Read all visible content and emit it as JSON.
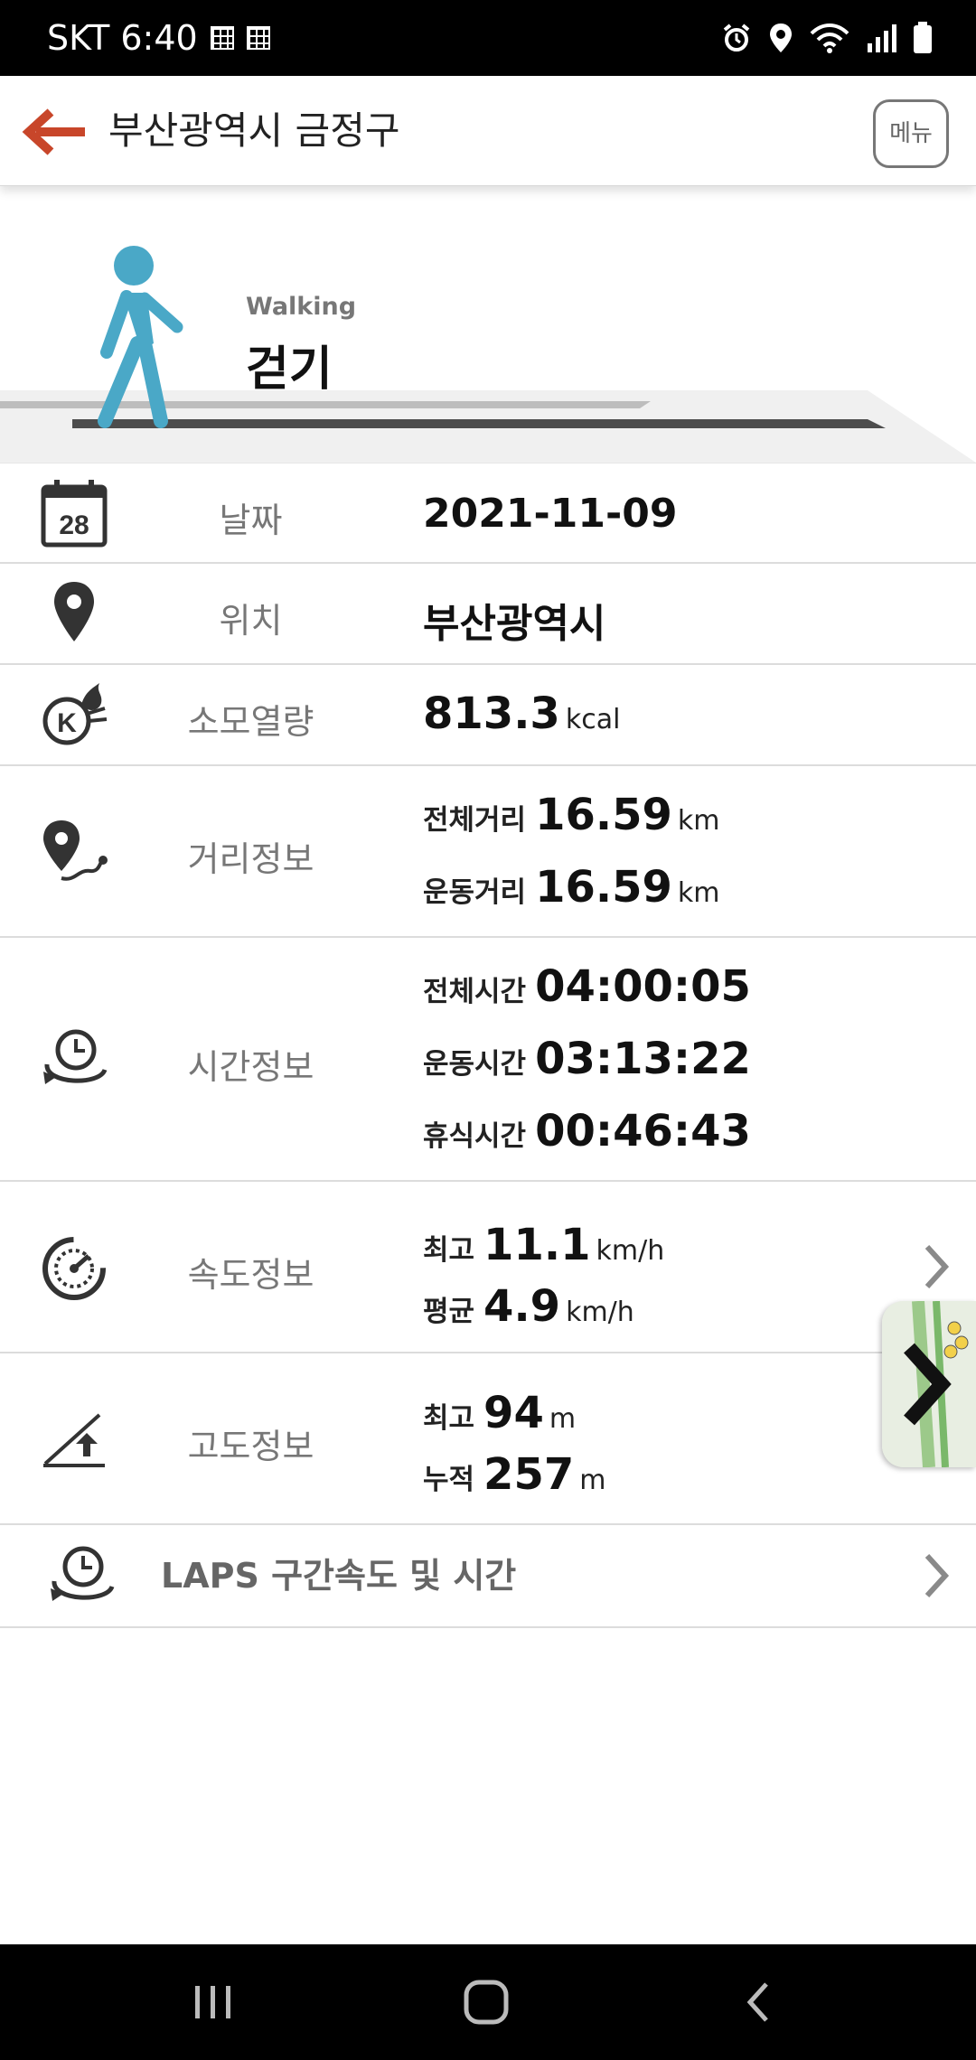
{
  "status_bar": {
    "carrier_time": "SKT 6:40"
  },
  "header": {
    "title": "부산광역시 금정구",
    "menu_label": "메뉴"
  },
  "activity": {
    "subtitle": "Walking",
    "title": "걷기",
    "accent_color": "#4aa8c7"
  },
  "rows": {
    "date": {
      "label": "날짜",
      "value": "2021-11-09"
    },
    "location": {
      "label": "위치",
      "value": "부산광역시"
    },
    "calories": {
      "label": "소모열량",
      "value": "813.3",
      "unit": "kcal"
    },
    "distance": {
      "label": "거리정보",
      "total_label": "전체거리",
      "total_value": "16.59",
      "total_unit": "km",
      "exercise_label": "운동거리",
      "exercise_value": "16.59",
      "exercise_unit": "km"
    },
    "time": {
      "label": "시간정보",
      "total_label": "전체시간",
      "total_value": "04:00:05",
      "exercise_label": "운동시간",
      "exercise_value": "03:13:22",
      "rest_label": "휴식시간",
      "rest_value": "00:46:43"
    },
    "speed": {
      "label": "속도정보",
      "max_label": "최고",
      "max_value": "11.1",
      "max_unit": "km/h",
      "avg_label": "평균",
      "avg_value": "4.9",
      "avg_unit": "km/h"
    },
    "altitude": {
      "label": "고도정보",
      "max_label": "최고",
      "max_value": "94",
      "max_unit": "m",
      "cum_label": "누적",
      "cum_value": "257",
      "cum_unit": "m"
    },
    "laps": {
      "label": "LAPS 구간속도 및 시간"
    }
  },
  "colors": {
    "back_arrow": "#c8462a",
    "label_gray": "#777777"
  }
}
